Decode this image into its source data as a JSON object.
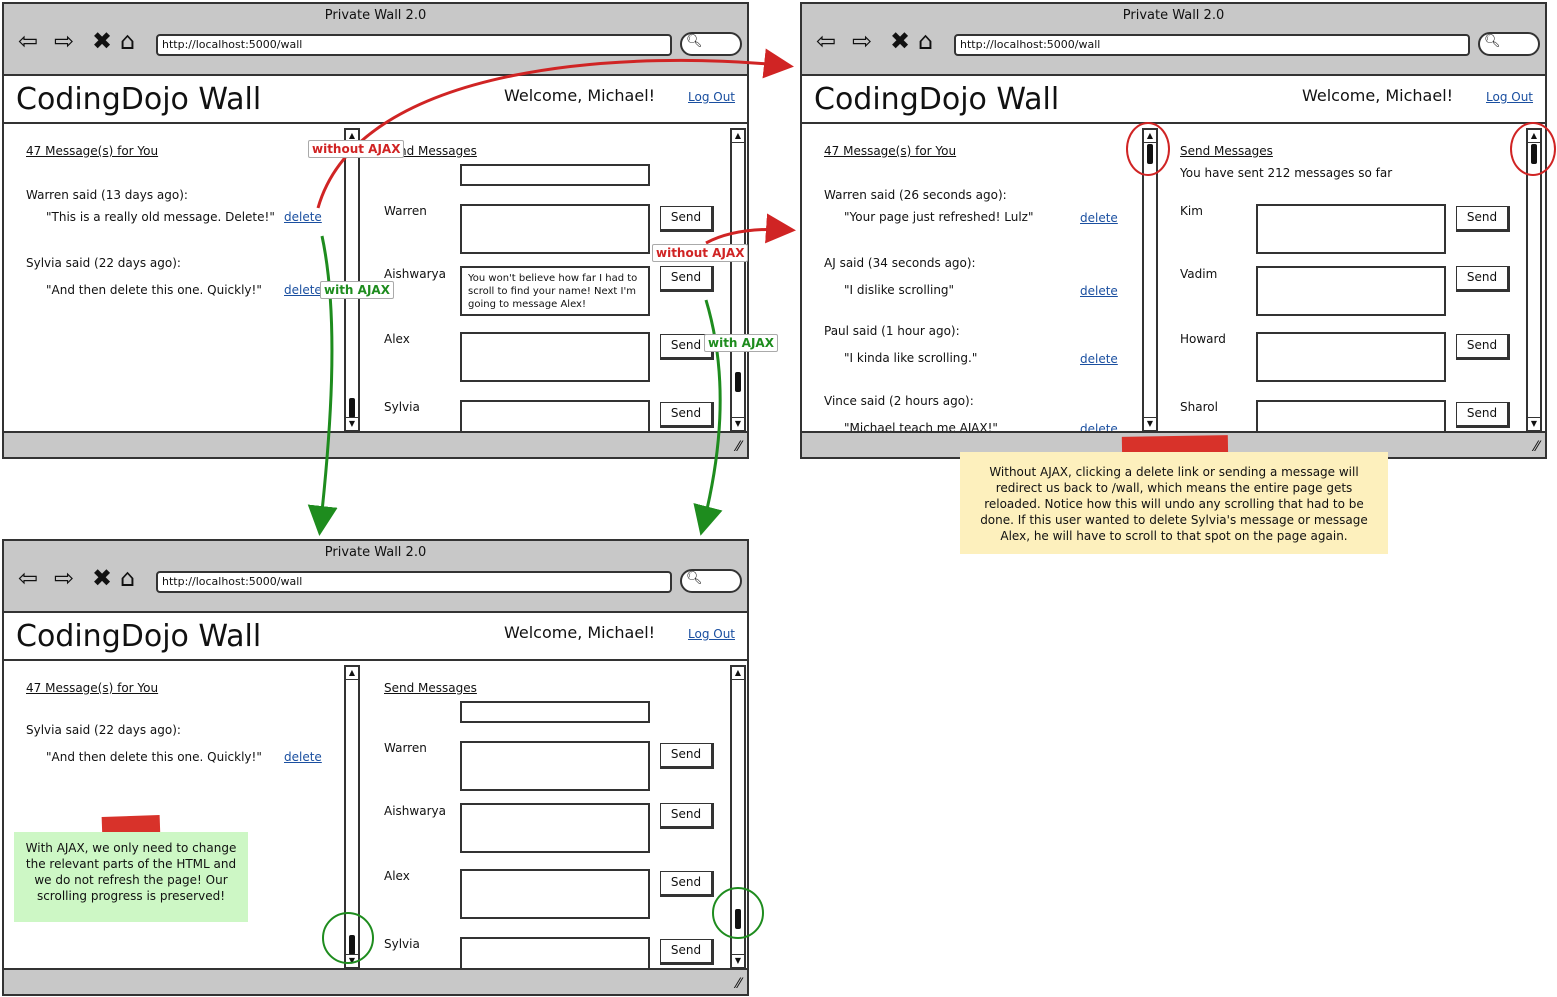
{
  "browser": {
    "title": "Private Wall 2.0",
    "url": "http://localhost:5000/wall"
  },
  "header": {
    "brand": "CodingDojo Wall",
    "welcome": "Welcome, Michael!",
    "logout": "Log Out"
  },
  "win1": {
    "messages_title": "47 Message(s) for You",
    "send_title": "Send Messages",
    "messages": [
      {
        "author": "Warren said (13 days ago):",
        "text": "\"This is a really old message. Delete!\"",
        "action": "delete"
      },
      {
        "author": "Sylvia said (22 days ago):",
        "text": "\"And then delete this one. Quickly!\"",
        "action": "delete"
      }
    ],
    "recipients": [
      "Warren",
      "Aishwarya",
      "Alex",
      "Sylvia"
    ],
    "draft": "You won't believe how far I had to scroll to find your name! Next I'm going to message Alex!",
    "send_label": "Send"
  },
  "win2": {
    "messages_title": "47 Message(s) for You",
    "send_title": "Send Messages",
    "sent_count": "You have sent 212 messages so far",
    "messages": [
      {
        "author": "Warren said (26 seconds ago):",
        "text": "\"Your page just refreshed! Lulz\"",
        "action": "delete"
      },
      {
        "author": "AJ said (34 seconds ago):",
        "text": "\"I dislike scrolling\"",
        "action": "delete"
      },
      {
        "author": "Paul said (1 hour ago):",
        "text": "\"I kinda like scrolling.\"",
        "action": "delete"
      },
      {
        "author": "Vince said (2 hours ago):",
        "text": "\"Michael teach me AJAX!\"",
        "action": "delete"
      }
    ],
    "recipients": [
      "Kim",
      "Vadim",
      "Howard",
      "Sharol"
    ],
    "send_label": "Send"
  },
  "win3": {
    "messages_title": "47 Message(s) for You",
    "send_title": "Send Messages",
    "messages": [
      {
        "author": "Sylvia said (22 days ago):",
        "text": "\"And then delete this one. Quickly!\"",
        "action": "delete"
      }
    ],
    "recipients": [
      "Warren",
      "Aishwarya",
      "Alex",
      "Sylvia"
    ],
    "send_label": "Send"
  },
  "annotations": {
    "without_ajax": "without AJAX",
    "with_ajax": "with AJAX"
  },
  "notes": {
    "without": "Without AJAX, clicking a delete link or sending a message will redirect us back to /wall, which means the entire page gets reloaded. Notice how this will undo any scrolling that had to be done. If this user wanted to delete Sylvia's message or message Alex, he will have to scroll to that spot on the page again.",
    "with": "With AJAX, we only need to change the relevant parts of the HTML and we do not refresh the page! Our scrolling progress is preserved!"
  },
  "colors": {
    "red": "#d02424",
    "green": "#1e8c1e",
    "note_yellow": "#fdf0bd",
    "note_green": "#cdf7c5",
    "link": "#1a4fa0"
  }
}
